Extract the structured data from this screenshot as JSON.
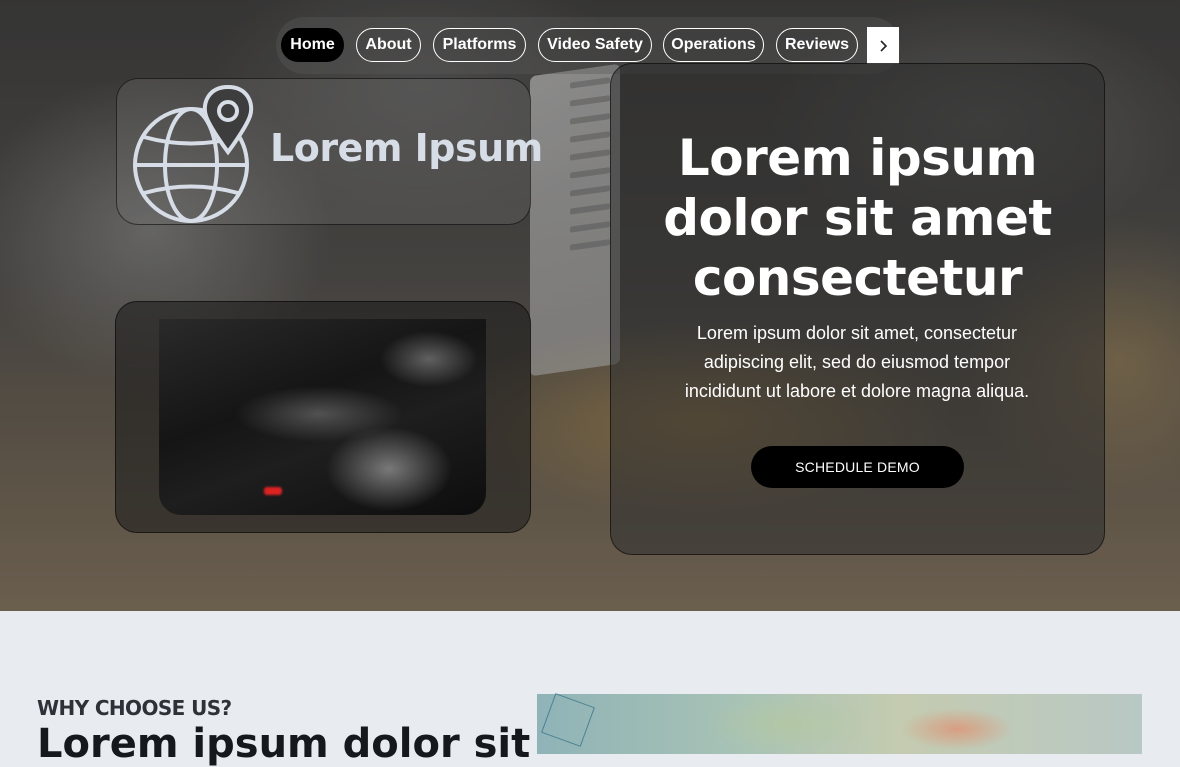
{
  "nav": {
    "items": [
      {
        "label": "Home",
        "active": true
      },
      {
        "label": "About"
      },
      {
        "label": "Platforms"
      },
      {
        "label": "Video Safety"
      },
      {
        "label": "Operations"
      },
      {
        "label": "Reviews"
      }
    ],
    "next_icon": "chevron-right-icon"
  },
  "logo": {
    "text": "Lorem Ipsum",
    "icon": "globe-location-pin-icon"
  },
  "hero": {
    "title_lines": [
      "Lorem ipsum",
      "dolor sit amet",
      "consectetur"
    ],
    "subtitle": "Lorem ipsum dolor sit amet, consectetur adipiscing elit, sed do eiusmod tempor incididunt ut labore et dolore magna aliqua.",
    "cta_label": "SCHEDULE DEMO"
  },
  "why": {
    "eyebrow": "WHY CHOOSE US?",
    "heading": "Lorem ipsum dolor sit"
  },
  "colors": {
    "nav_active_bg": "#000000",
    "cta_bg": "#000000",
    "logo_text": "#d7dde6",
    "section_bg": "#e8ebef"
  }
}
